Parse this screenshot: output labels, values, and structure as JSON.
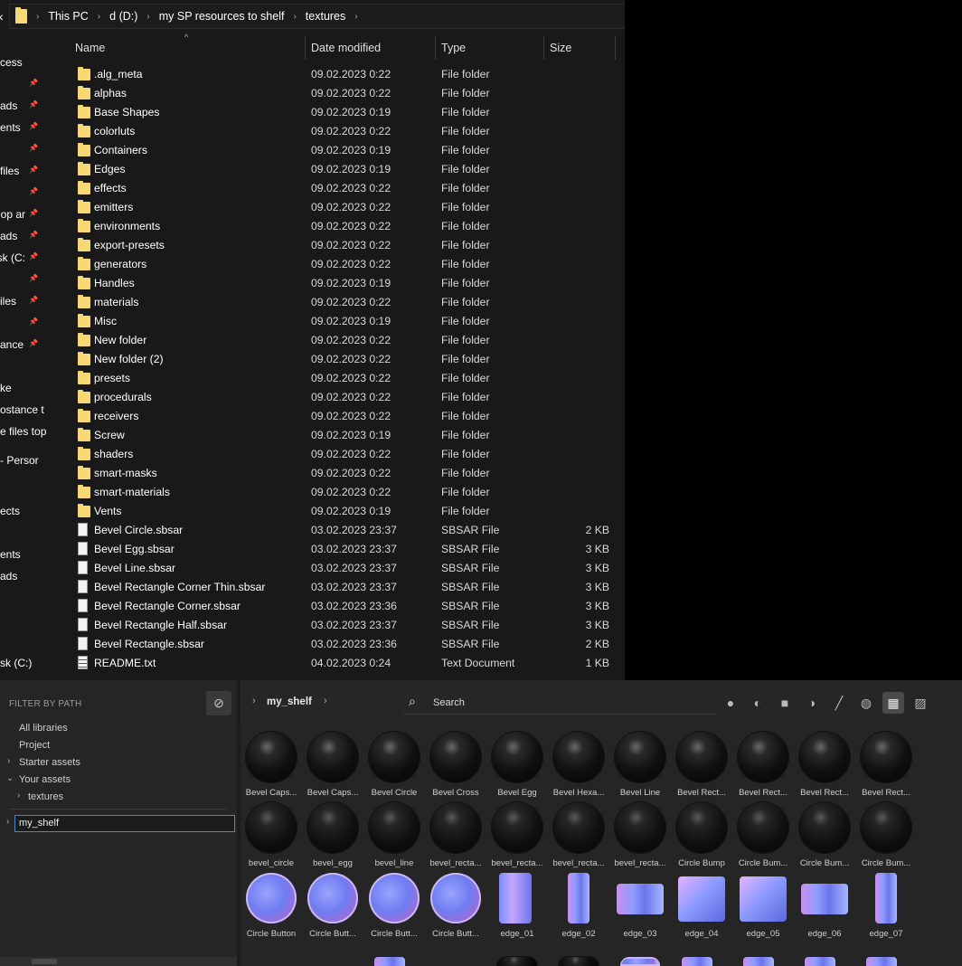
{
  "explorer": {
    "breadcrumbs": [
      "This PC",
      "d (D:)",
      "my SP resources to shelf",
      "textures"
    ],
    "columns": {
      "name": "Name",
      "date": "Date modified",
      "type": "Type",
      "size": "Size"
    },
    "nav_items": [
      {
        "label": "cess",
        "pin": false
      },
      {
        "label": "",
        "pin": true
      },
      {
        "label": "ads",
        "pin": true
      },
      {
        "label": "ents",
        "pin": true
      },
      {
        "label": "",
        "pin": true
      },
      {
        "label": "files",
        "pin": true
      },
      {
        "label": "",
        "pin": true
      },
      {
        "label": "hop ar",
        "pin": true
      },
      {
        "label": "ads",
        "pin": true
      },
      {
        "label": "sk (C:",
        "pin": true
      },
      {
        "label": "",
        "pin": true
      },
      {
        "label": "iles",
        "pin": true
      },
      {
        "label": "",
        "pin": true
      },
      {
        "label": "ance",
        "pin": true
      },
      {
        "label": "",
        "pin": false
      },
      {
        "label": "ke",
        "pin": false
      },
      {
        "label": "ostance t",
        "pin": false
      },
      {
        "label": "e files top",
        "pin": false
      },
      {
        "label": "- Persor",
        "pin": false
      },
      {
        "label": "",
        "pin": false
      },
      {
        "label": "ects",
        "pin": false
      },
      {
        "label": "",
        "pin": false
      },
      {
        "label": "ents",
        "pin": false
      },
      {
        "label": "ads",
        "pin": false
      },
      {
        "label": "",
        "pin": false
      },
      {
        "label": "",
        "pin": false
      },
      {
        "label": "",
        "pin": false
      },
      {
        "label": "sk (C:)",
        "pin": false
      }
    ],
    "rows": [
      {
        "icon": "folder",
        "name": ".alg_meta",
        "date": "09.02.2023 0:22",
        "type": "File folder",
        "size": ""
      },
      {
        "icon": "folder",
        "name": "alphas",
        "date": "09.02.2023 0:22",
        "type": "File folder",
        "size": ""
      },
      {
        "icon": "folder",
        "name": "Base Shapes",
        "date": "09.02.2023 0:19",
        "type": "File folder",
        "size": ""
      },
      {
        "icon": "folder",
        "name": "colorluts",
        "date": "09.02.2023 0:22",
        "type": "File folder",
        "size": ""
      },
      {
        "icon": "folder",
        "name": "Containers",
        "date": "09.02.2023 0:19",
        "type": "File folder",
        "size": ""
      },
      {
        "icon": "folder",
        "name": "Edges",
        "date": "09.02.2023 0:19",
        "type": "File folder",
        "size": ""
      },
      {
        "icon": "folder",
        "name": "effects",
        "date": "09.02.2023 0:22",
        "type": "File folder",
        "size": ""
      },
      {
        "icon": "folder",
        "name": "emitters",
        "date": "09.02.2023 0:22",
        "type": "File folder",
        "size": ""
      },
      {
        "icon": "folder",
        "name": "environments",
        "date": "09.02.2023 0:22",
        "type": "File folder",
        "size": ""
      },
      {
        "icon": "folder",
        "name": "export-presets",
        "date": "09.02.2023 0:22",
        "type": "File folder",
        "size": ""
      },
      {
        "icon": "folder",
        "name": "generators",
        "date": "09.02.2023 0:22",
        "type": "File folder",
        "size": ""
      },
      {
        "icon": "folder",
        "name": "Handles",
        "date": "09.02.2023 0:19",
        "type": "File folder",
        "size": ""
      },
      {
        "icon": "folder",
        "name": "materials",
        "date": "09.02.2023 0:22",
        "type": "File folder",
        "size": ""
      },
      {
        "icon": "folder",
        "name": "Misc",
        "date": "09.02.2023 0:19",
        "type": "File folder",
        "size": ""
      },
      {
        "icon": "folder",
        "name": "New folder",
        "date": "09.02.2023 0:22",
        "type": "File folder",
        "size": ""
      },
      {
        "icon": "folder",
        "name": "New folder (2)",
        "date": "09.02.2023 0:22",
        "type": "File folder",
        "size": ""
      },
      {
        "icon": "folder",
        "name": "presets",
        "date": "09.02.2023 0:22",
        "type": "File folder",
        "size": ""
      },
      {
        "icon": "folder",
        "name": "procedurals",
        "date": "09.02.2023 0:22",
        "type": "File folder",
        "size": ""
      },
      {
        "icon": "folder",
        "name": "receivers",
        "date": "09.02.2023 0:22",
        "type": "File folder",
        "size": ""
      },
      {
        "icon": "folder",
        "name": "Screw",
        "date": "09.02.2023 0:19",
        "type": "File folder",
        "size": ""
      },
      {
        "icon": "folder",
        "name": "shaders",
        "date": "09.02.2023 0:22",
        "type": "File folder",
        "size": ""
      },
      {
        "icon": "folder",
        "name": "smart-masks",
        "date": "09.02.2023 0:22",
        "type": "File folder",
        "size": ""
      },
      {
        "icon": "folder",
        "name": "smart-materials",
        "date": "09.02.2023 0:22",
        "type": "File folder",
        "size": ""
      },
      {
        "icon": "folder",
        "name": "Vents",
        "date": "09.02.2023 0:19",
        "type": "File folder",
        "size": ""
      },
      {
        "icon": "file",
        "name": "Bevel Circle.sbsar",
        "date": "03.02.2023 23:37",
        "type": "SBSAR File",
        "size": "2 KB"
      },
      {
        "icon": "file",
        "name": "Bevel Egg.sbsar",
        "date": "03.02.2023 23:37",
        "type": "SBSAR File",
        "size": "3 KB"
      },
      {
        "icon": "file",
        "name": "Bevel Line.sbsar",
        "date": "03.02.2023 23:37",
        "type": "SBSAR File",
        "size": "3 KB"
      },
      {
        "icon": "file",
        "name": "Bevel Rectangle Corner Thin.sbsar",
        "date": "03.02.2023 23:37",
        "type": "SBSAR File",
        "size": "3 KB"
      },
      {
        "icon": "file",
        "name": "Bevel Rectangle Corner.sbsar",
        "date": "03.02.2023 23:36",
        "type": "SBSAR File",
        "size": "3 KB"
      },
      {
        "icon": "file",
        "name": "Bevel Rectangle Half.sbsar",
        "date": "03.02.2023 23:37",
        "type": "SBSAR File",
        "size": "3 KB"
      },
      {
        "icon": "file",
        "name": "Bevel Rectangle.sbsar",
        "date": "03.02.2023 23:36",
        "type": "SBSAR File",
        "size": "2 KB"
      },
      {
        "icon": "text",
        "name": "README.txt",
        "date": "04.02.2023 0:24",
        "type": "Text Document",
        "size": "1 KB"
      }
    ]
  },
  "shelf": {
    "filter_title": "FILTER BY PATH",
    "tree": [
      {
        "label": "All libraries",
        "arrow": ""
      },
      {
        "label": "Project",
        "arrow": ""
      },
      {
        "label": "Starter assets",
        "arrow": "›"
      },
      {
        "label": "Your assets",
        "arrow": "⌄"
      },
      {
        "label": "textures",
        "arrow": "›"
      }
    ],
    "path_input_value": "my_shelf",
    "breadcrumb": "my_shelf",
    "search_placeholder": "Search",
    "filter_buttons": [
      {
        "icon": "sphere-material-icon",
        "glyph": "●",
        "active": false
      },
      {
        "icon": "smart-material-icon",
        "glyph": "◐",
        "active": false
      },
      {
        "icon": "texture-icon",
        "glyph": "■",
        "active": false
      },
      {
        "icon": "filter-icon",
        "glyph": "◑",
        "active": false
      },
      {
        "icon": "brush-icon",
        "glyph": "╱",
        "active": false
      },
      {
        "icon": "alpha-icon",
        "glyph": "◍",
        "active": false
      },
      {
        "icon": "procedural-icon",
        "glyph": "▦",
        "active": true
      },
      {
        "icon": "environment-icon",
        "glyph": "▨",
        "active": false
      }
    ],
    "thumbnails": [
      {
        "label": "Bevel Caps...",
        "kind": "sphere"
      },
      {
        "label": "Bevel Caps...",
        "kind": "sphere"
      },
      {
        "label": "Bevel Circle",
        "kind": "sphere"
      },
      {
        "label": "Bevel Cross",
        "kind": "sphere"
      },
      {
        "label": "Bevel Egg",
        "kind": "sphere"
      },
      {
        "label": "Bevel Hexa...",
        "kind": "sphere"
      },
      {
        "label": "Bevel Line",
        "kind": "sphere"
      },
      {
        "label": "Bevel Rect...",
        "kind": "sphere"
      },
      {
        "label": "Bevel Rect...",
        "kind": "sphere"
      },
      {
        "label": "Bevel Rect...",
        "kind": "sphere"
      },
      {
        "label": "Bevel Rect...",
        "kind": "sphere"
      },
      {
        "label": "bevel_circle",
        "kind": "sphere2"
      },
      {
        "label": "bevel_egg",
        "kind": "sphere2"
      },
      {
        "label": "bevel_line",
        "kind": "sphere2"
      },
      {
        "label": "bevel_recta...",
        "kind": "sphere2"
      },
      {
        "label": "bevel_recta...",
        "kind": "sphere2"
      },
      {
        "label": "bevel_recta...",
        "kind": "sphere2"
      },
      {
        "label": "bevel_recta...",
        "kind": "sphere2"
      },
      {
        "label": "Circle Bump",
        "kind": "sphere2"
      },
      {
        "label": "Circle Bum...",
        "kind": "sphere2"
      },
      {
        "label": "Circle Bum...",
        "kind": "sphere2"
      },
      {
        "label": "Circle Bum...",
        "kind": "sphere2"
      },
      {
        "label": "Circle Button",
        "kind": "nbutton"
      },
      {
        "label": "Circle Butt...",
        "kind": "nbutton"
      },
      {
        "label": "Circle Butt...",
        "kind": "nbutton"
      },
      {
        "label": "Circle Butt...",
        "kind": "nbutton"
      },
      {
        "label": "edge_01",
        "kind": "edge-d"
      },
      {
        "label": "edge_02",
        "kind": "edge-tall"
      },
      {
        "label": "edge_03",
        "kind": "edge-wide"
      },
      {
        "label": "edge_04",
        "kind": "edge-sq"
      },
      {
        "label": "edge_05",
        "kind": "edge-sq"
      },
      {
        "label": "edge_06",
        "kind": "edge-wide"
      },
      {
        "label": "edge_07",
        "kind": "edge-tall"
      }
    ],
    "colors": {
      "accent": "#4a89c9",
      "folder": "#f8d775",
      "panel": "#252525"
    }
  }
}
